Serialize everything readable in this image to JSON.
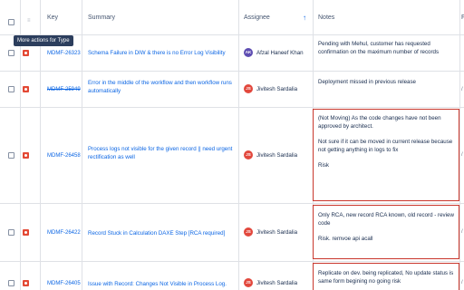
{
  "header": {
    "key": "Key",
    "summary": "Summary",
    "assignee": "Assignee",
    "notes": "Notes",
    "extra": "F",
    "sort_icon": "arrow-up-icon",
    "sort_glyph": "↑"
  },
  "tooltip": "More actions for Type",
  "rows": [
    {
      "key": "MDMF-26323",
      "key_done": false,
      "summary": "Schema Failure in DIW & there is no Error Log Visibility",
      "assignee": "Afzal Haneef Khan",
      "initials": "AK",
      "notes": [
        "Pending with Mehul, customer has requested confirmation on the maximum number of records"
      ],
      "highlighted": false
    },
    {
      "key": "MDMF-25949",
      "key_done": true,
      "summary": "Error in the middle of the workflow and then workflow runs automatically",
      "assignee": "Jivitesh Sardalia",
      "initials": "JS",
      "notes": [
        "Deployment missed in previous release"
      ],
      "highlighted": false,
      "edge": "/"
    },
    {
      "key": "MDMF-26458",
      "key_done": false,
      "summary": "Process logs not visible for the given record || need urgent rectification as well",
      "assignee": "Jivitesh Sardalia",
      "initials": "JS",
      "notes": [
        "(Not Moving) As the code changes have not been approved by architect.",
        "Not sure if it can be moved in current release because not getting anything in logs to fix",
        "Risk"
      ],
      "highlighted": true,
      "edge": "/"
    },
    {
      "key": "MDMF-26422",
      "key_done": false,
      "summary": "Record Stuck in Calculation DAXE Step [RCA required]",
      "assignee": "Jivitesh Sardalia",
      "initials": "JS",
      "notes": [
        "Only RCA, new record RCA known, old record - review code",
        "Risk. remvoe api acall"
      ],
      "highlighted": true,
      "edge": "/"
    },
    {
      "key": "MDMF-26405",
      "key_done": false,
      "summary": "Issue with Record: Changes Not Visible in Process Log.",
      "assignee": "Jivitesh Sardalia",
      "initials": "JS",
      "notes": [
        "Replicate on dev. being replicated, No update status is same form begining no going risk"
      ],
      "highlighted": true,
      "edge": "/"
    }
  ],
  "colors": {
    "link": "#0c66e4",
    "bug": "#e34935",
    "highlight_border": "#c9372c",
    "avatar_ak": "#5e4db2",
    "avatar_js": "#e2483d"
  }
}
